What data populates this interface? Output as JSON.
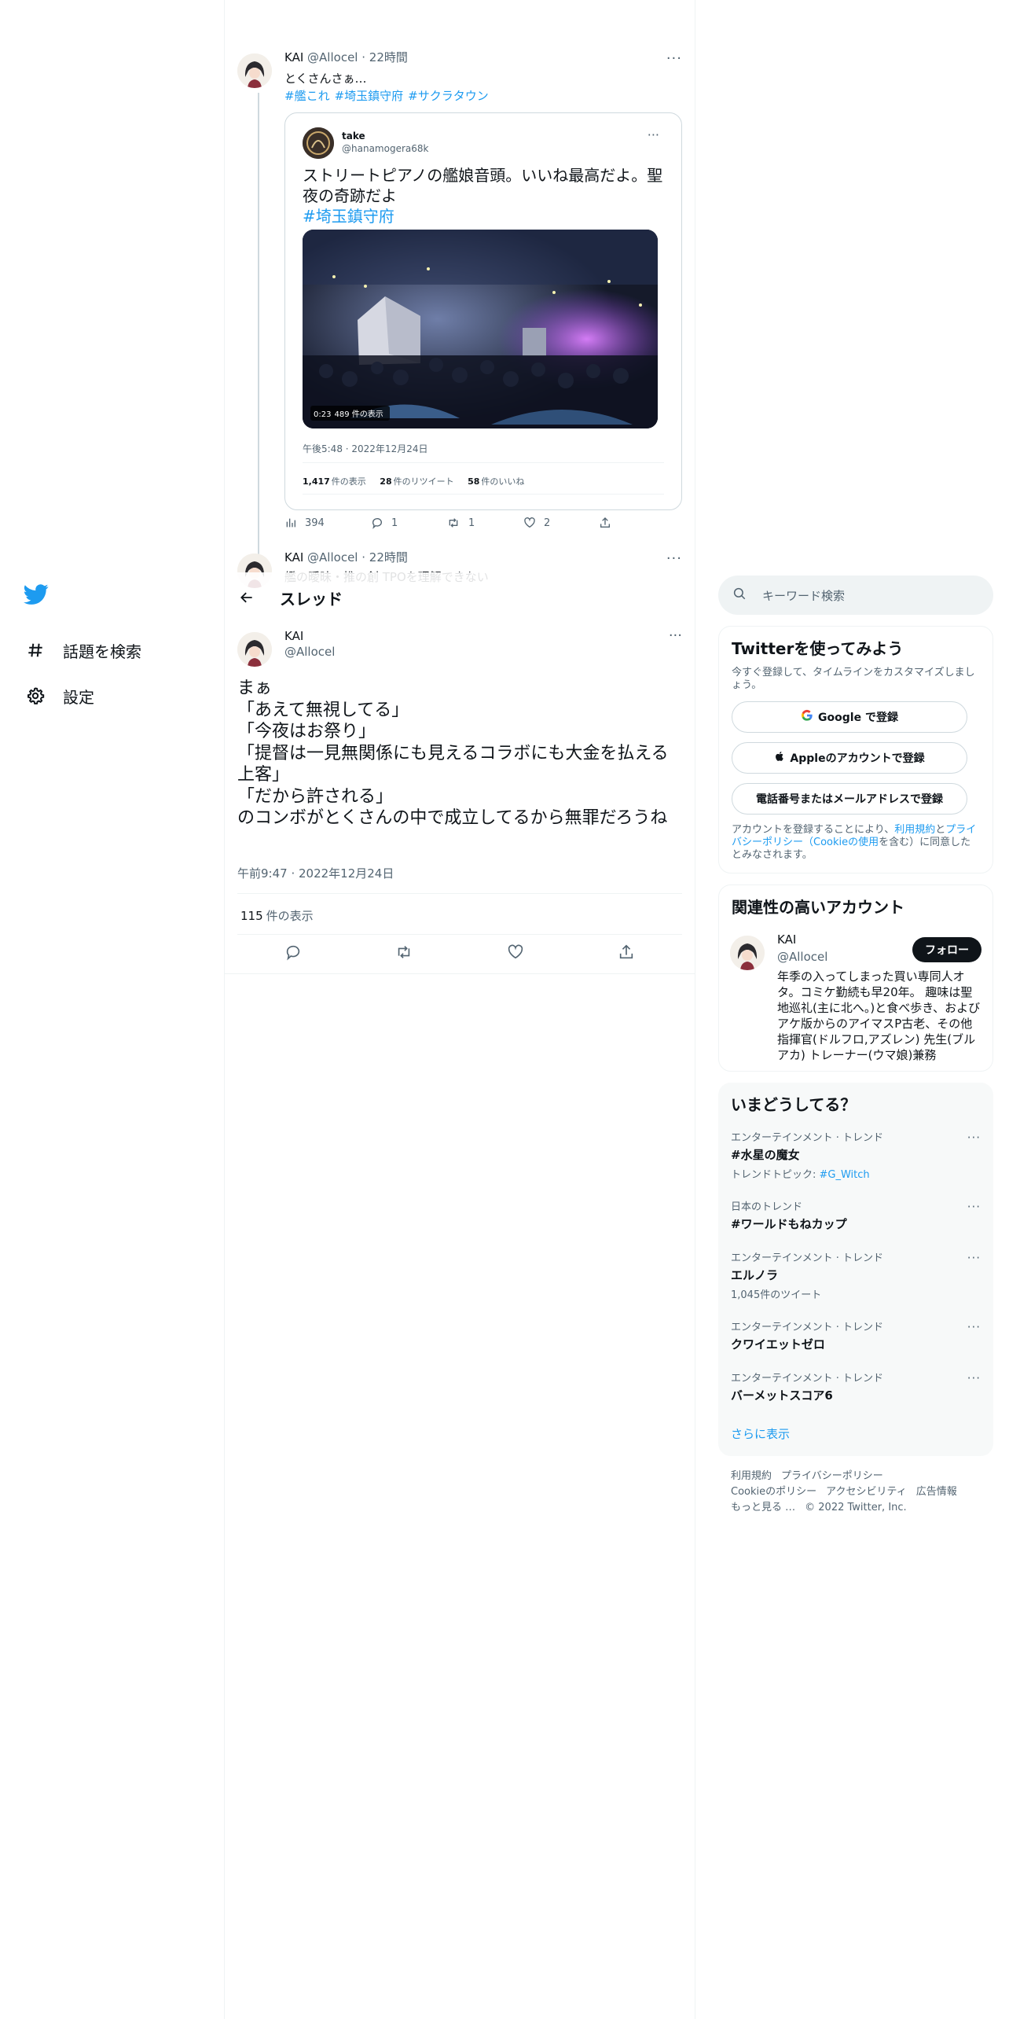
{
  "nav": {
    "items": [
      {
        "label": "話題を検索",
        "icon": "hashtag-icon"
      },
      {
        "label": "設定",
        "icon": "gear-icon"
      }
    ]
  },
  "tweet1": {
    "name": "KAI",
    "handle": "@Allocel",
    "time": "22時間",
    "text": "とくさんさぁ…",
    "tags": [
      "#艦これ",
      "#埼玉鎮守府",
      "#サクラタウン"
    ],
    "quote": {
      "name": "take",
      "handle": "@hanamogera68k",
      "text": "ストリートピアノの艦娘音頭。いいね最高だよ。聖夜の奇跡だよ",
      "tag": "#埼玉鎮守府",
      "video_duration": "0:23",
      "video_views": "489 件の表示",
      "time": "午後5:48 · 2022年12月24日",
      "views": "1,417",
      "views_label": "件の表示",
      "retweets": "28",
      "retweets_label": "件のリツイート",
      "likes": "58",
      "likes_label": "件のいいね"
    },
    "actions": {
      "views": "394",
      "replies": "1",
      "retweets": "1",
      "likes": "2"
    }
  },
  "tweet2": {
    "name": "KAI",
    "handle": "@Allocel",
    "time": "22時間",
    "text": "艦の曖昧・推の創 TPOを理解できない"
  },
  "header": {
    "title": "スレッド"
  },
  "focus": {
    "name": "KAI",
    "handle": "@Allocel",
    "lines": [
      "まぁ",
      "「あえて無視してる」",
      "「今夜はお祭り」",
      "「提督は一見無関係にも見えるコラボにも大金を払える上客」",
      "「だから許される」",
      "のコンボがとくさんの中で成立してるから無罪だろうね"
    ],
    "time": "午前9:47 · 2022年12月24日",
    "views": "115",
    "views_label": "件の表示"
  },
  "search": {
    "placeholder": "キーワード検索"
  },
  "signup": {
    "title": "Twitterを使ってみよう",
    "subtitle": "今すぐ登録して、タイムラインをカスタマイズしましょう。",
    "google": "Google で登録",
    "apple": "Appleのアカウントで登録",
    "phone": "電話番号またはメールアドレスで登録",
    "legal_prefix": "アカウントを登録することにより、",
    "terms": "利用規約",
    "and": "と",
    "privacy": "プライバシーポリシー（Cookieの使用",
    "legal_suffix": "を含む）に同意したとみなされます。"
  },
  "related": {
    "title": "関連性の高いアカウント",
    "name": "KAI",
    "handle": "@Allocel",
    "follow": "フォロー",
    "bio": "年季の入ってしまった買い専同人オタ。コミケ勤続も早20年。 趣味は聖地巡礼(主に北へ。)と食べ歩き、およびアケ版からのアイマスP古老、その他 指揮官(ドルフロ,アズレン) 先生(ブルアカ) トレーナー(ウマ娘)兼務"
  },
  "trends": {
    "title": "いまどうしてる？",
    "items": [
      {
        "context": "エンターテインメント · トレンド",
        "name": "#水星の魔女",
        "sub_prefix": "トレンドトピック: ",
        "sub_link": "#G_Witch"
      },
      {
        "context": "日本のトレンド",
        "name": "#ワールドもねカップ",
        "sub_prefix": "",
        "sub_link": ""
      },
      {
        "context": "エンターテインメント · トレンド",
        "name": "エルノラ",
        "sub_prefix": "1,045件のツイート",
        "sub_link": ""
      },
      {
        "context": "エンターテインメント · トレンド",
        "name": "クワイエットゼロ",
        "sub_prefix": "",
        "sub_link": ""
      },
      {
        "context": "エンターテインメント · トレンド",
        "name": "バーメットスコア6",
        "sub_prefix": "",
        "sub_link": ""
      }
    ],
    "show_more": "さらに表示"
  },
  "footer": {
    "links": [
      "利用規約",
      "プライバシーポリシー",
      "Cookieのポリシー",
      "アクセシビリティ",
      "広告情報",
      "もっと見る …",
      "© 2022 Twitter, Inc."
    ]
  },
  "colors": {
    "accent": "#1d9bf0",
    "text": "#0f1419",
    "muted": "#536471",
    "border": "#eff3f4"
  }
}
